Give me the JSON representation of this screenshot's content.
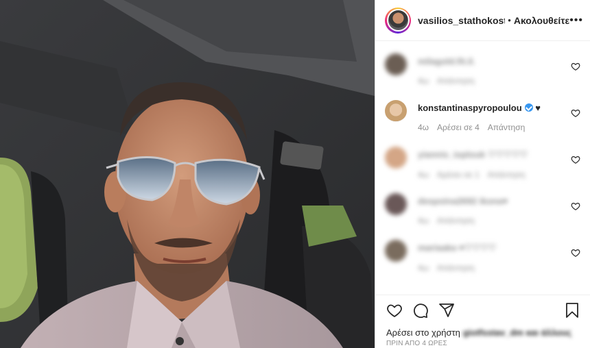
{
  "header": {
    "username": "vasilios_stathokostc",
    "separator": "•",
    "follow_label": "Ακολουθείτε",
    "more_label": "•••"
  },
  "comments": [
    {
      "user": "milagold.fit.il.",
      "time": "4ω",
      "likes": "Απάντηση",
      "reply": "",
      "blurred": true,
      "avatar_color": "#6b5e54",
      "verified": false,
      "suffix": ""
    },
    {
      "user": "konstantinaspyropoulou",
      "time": "4ω",
      "likes": "Αρέσει σε 4",
      "reply": "Απάντηση",
      "blurred": false,
      "avatar_color": "#d9b995",
      "verified": true,
      "suffix": "♥"
    },
    {
      "user": "yiannis_ioplouk ♡♡♡♡♡",
      "time": "4ω",
      "likes": "Αρέσει σε 1",
      "reply": "Απάντηση",
      "blurred": true,
      "avatar_color": "#d4a686",
      "verified": false,
      "suffix": ""
    },
    {
      "user": "despoina2692 ikona♥",
      "time": "4ω",
      "likes": "Απάντηση",
      "reply": "",
      "blurred": true,
      "avatar_color": "#6a5858",
      "verified": false,
      "suffix": ""
    },
    {
      "user": "mariaaka ♥♡♡♡♡",
      "time": "4ω",
      "likes": "Απάντηση",
      "reply": "",
      "blurred": true,
      "avatar_color": "#7a6c5e",
      "verified": false,
      "suffix": ""
    }
  ],
  "likes": {
    "prefix": "Αρέσει στο χρήστη",
    "name": "giotfsstav_dm και άλλους"
  },
  "timestamp": "ΠΡΙΝ ΑΠΟ 4 ΩΡΕΣ",
  "icons": {
    "like": "heart-outline-icon",
    "comment": "speech-bubble-icon",
    "share": "paper-plane-icon",
    "save": "bookmark-icon",
    "comment_like": "small-heart-icon"
  },
  "colors": {
    "verified": "#3897f0",
    "text": "#262626",
    "secondary": "#8e8e8e",
    "border": "#dbdbdb"
  }
}
